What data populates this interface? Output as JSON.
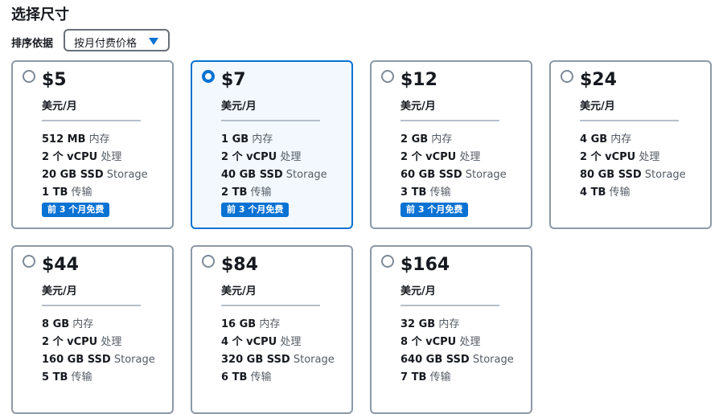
{
  "title": "选择尺寸",
  "sort": {
    "label": "排序依据",
    "selected": "按月付费价格"
  },
  "colors": {
    "accent": "#0972d3",
    "border": "#8d99a8",
    "selected_bg": "#f2f8fd"
  },
  "plans": [
    {
      "price": "$5",
      "period": "美元/月",
      "memory": "512 MB",
      "memory_unit": "内存",
      "cpu": "2 个 vCPU",
      "cpu_unit": "处理",
      "storage": "20 GB SSD",
      "storage_unit": "Storage",
      "transfer": "1 TB",
      "transfer_unit": "传输",
      "badge": "前 3 个月免费",
      "selected": false
    },
    {
      "price": "$7",
      "period": "美元/月",
      "memory": "1 GB",
      "memory_unit": "内存",
      "cpu": "2 个 vCPU",
      "cpu_unit": "处理",
      "storage": "40 GB SSD",
      "storage_unit": "Storage",
      "transfer": "2 TB",
      "transfer_unit": "传输",
      "badge": "前 3 个月免费",
      "selected": true
    },
    {
      "price": "$12",
      "period": "美元/月",
      "memory": "2 GB",
      "memory_unit": "内存",
      "cpu": "2 个 vCPU",
      "cpu_unit": "处理",
      "storage": "60 GB SSD",
      "storage_unit": "Storage",
      "transfer": "3 TB",
      "transfer_unit": "传输",
      "badge": "前 3 个月免费",
      "selected": false
    },
    {
      "price": "$24",
      "period": "美元/月",
      "memory": "4 GB",
      "memory_unit": "内存",
      "cpu": "2 个 vCPU",
      "cpu_unit": "处理",
      "storage": "80 GB SSD",
      "storage_unit": "Storage",
      "transfer": "4 TB",
      "transfer_unit": "传输",
      "badge": "",
      "selected": false
    },
    {
      "price": "$44",
      "period": "美元/月",
      "memory": "8 GB",
      "memory_unit": "内存",
      "cpu": "2 个 vCPU",
      "cpu_unit": "处理",
      "storage": "160 GB SSD",
      "storage_unit": "Storage",
      "transfer": "5 TB",
      "transfer_unit": "传输",
      "badge": "",
      "selected": false
    },
    {
      "price": "$84",
      "period": "美元/月",
      "memory": "16 GB",
      "memory_unit": "内存",
      "cpu": "4 个 vCPU",
      "cpu_unit": "处理",
      "storage": "320 GB SSD",
      "storage_unit": "Storage",
      "transfer": "6 TB",
      "transfer_unit": "传输",
      "badge": "",
      "selected": false
    },
    {
      "price": "$164",
      "period": "美元/月",
      "memory": "32 GB",
      "memory_unit": "内存",
      "cpu": "8 个 vCPU",
      "cpu_unit": "处理",
      "storage": "640 GB SSD",
      "storage_unit": "Storage",
      "transfer": "7 TB",
      "transfer_unit": "传输",
      "badge": "",
      "selected": false
    }
  ]
}
